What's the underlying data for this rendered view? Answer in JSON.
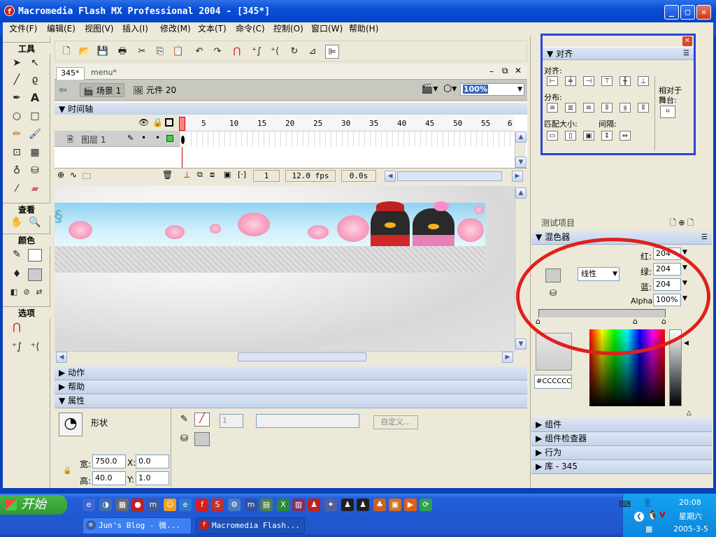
{
  "window": {
    "title": "Macromedia Flash MX Professional 2004 - [345*]",
    "app_icon": "flash-icon",
    "controls": [
      "minimize",
      "maximize",
      "close"
    ]
  },
  "menu": [
    "文件(F)",
    "编辑(E)",
    "视图(V)",
    "插入(I)",
    "修改(M)",
    "文本(T)",
    "命令(C)",
    "控制(O)",
    "窗口(W)",
    "帮助(H)"
  ],
  "tools": {
    "title": "工具",
    "view_title": "查看",
    "color_title": "颜色",
    "options_title": "选项"
  },
  "document": {
    "tabs": [
      "345*",
      "menu*"
    ],
    "scene": "场景 1",
    "symbol": "元件 20",
    "zoom": "100%"
  },
  "timeline": {
    "title": "时间轴",
    "ruler": [
      "1",
      "5",
      "10",
      "15",
      "20",
      "25",
      "30",
      "35",
      "40",
      "45",
      "50",
      "55",
      "6"
    ],
    "layer": "图层 1",
    "frame": "1",
    "fps": "12.0 fps",
    "time": "0.0s"
  },
  "panels_collapsed": [
    "动作",
    "帮助"
  ],
  "properties": {
    "title": "属性",
    "shape_label": "形状",
    "width_label": "宽:",
    "width": "750.0",
    "height_label": "高:",
    "height": "40.0",
    "x_label": "X:",
    "x": "0.0",
    "y_label": "Y:",
    "y": "1.0",
    "stroke_value": "1",
    "custom_button": "自定义..."
  },
  "align": {
    "title": "对齐",
    "align_label": "对齐:",
    "distribute_label": "分布:",
    "match_size_label": "匹配大小:",
    "spacing_label": "间隔:",
    "to_stage_line1": "相对于",
    "to_stage_line2": "舞台:"
  },
  "test_project": "测试项目",
  "mixer": {
    "title": "混色器",
    "type": "线性",
    "red_label": "红:",
    "red": "204",
    "green_label": "绿:",
    "green": "204",
    "blue_label": "蓝:",
    "blue": "204",
    "alpha_label": "Alpha:",
    "alpha": "100%",
    "hex": "#CCCCCC",
    "color": "#CCCCCC"
  },
  "right_panels": [
    "组件",
    "组件检查器",
    "行为",
    "库 - 345"
  ],
  "taskbar": {
    "start": "开始",
    "tasks": [
      "Jun's Blog - 微...",
      "Macromedia Flash..."
    ],
    "time": "20:08",
    "weekday": "星期六",
    "date": "2005-3-5"
  }
}
